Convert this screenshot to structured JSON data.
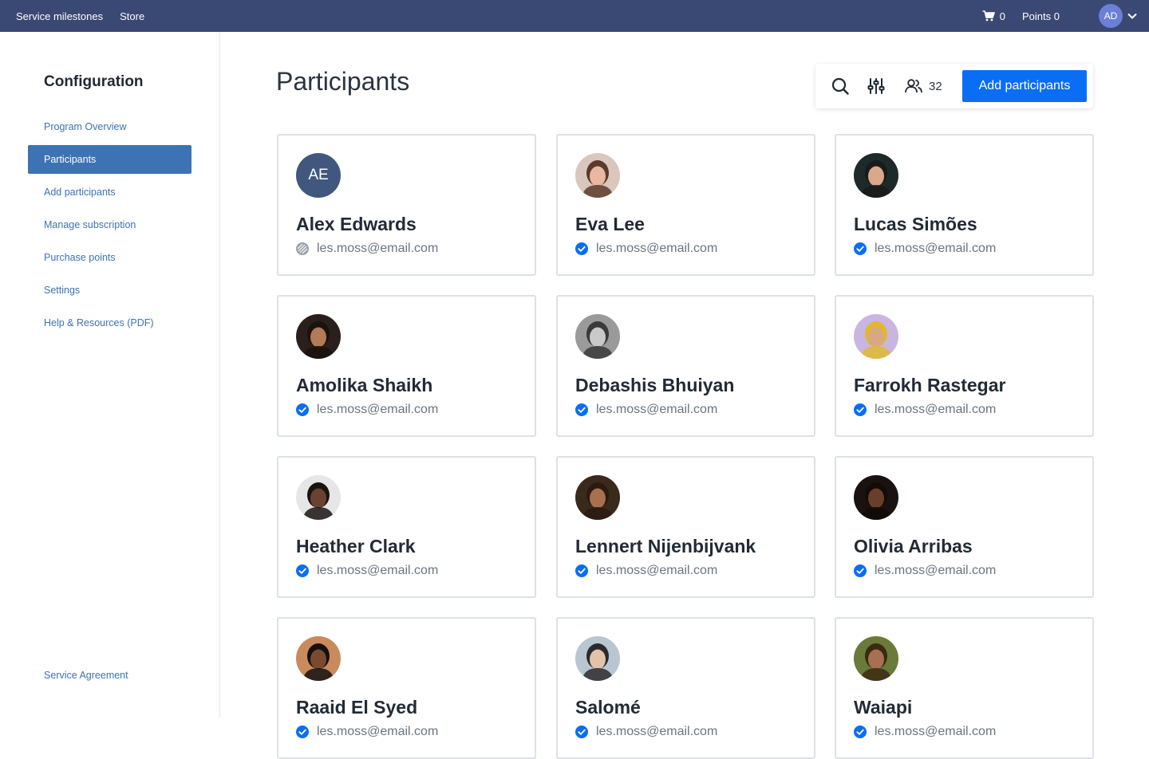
{
  "topbar": {
    "links": [
      "Service milestones",
      "Store"
    ],
    "cart_count": "0",
    "points_label": "Points 0",
    "user_initials": "AD",
    "colors": {
      "background": "#3a4874",
      "avatar": "#6b7fd7"
    }
  },
  "sidebar": {
    "title": "Configuration",
    "items": [
      {
        "label": "Program Overview",
        "active": false
      },
      {
        "label": "Participants",
        "active": true
      },
      {
        "label": "Add participants",
        "active": false
      },
      {
        "label": "Manage subscription",
        "active": false
      },
      {
        "label": "Purchase points",
        "active": false
      },
      {
        "label": "Settings",
        "active": false
      },
      {
        "label": "Help & Resources (PDF)",
        "active": false
      }
    ],
    "footer": "Service Agreement",
    "accent": "#3d72b4"
  },
  "main": {
    "title": "Participants",
    "toolbar": {
      "search_icon": "search-icon",
      "filter_icon": "sliders-icon",
      "participant_icon": "users-icon",
      "participant_count": "32",
      "add_button": "Add participants",
      "button_color": "#0a6ef5"
    },
    "participants": [
      {
        "name": "Alex Edwards",
        "email": "les.moss@email.com",
        "initials": "AE",
        "verified": false
      },
      {
        "name": "Eva Lee",
        "email": "les.moss@email.com",
        "verified": true,
        "skin": "#e8b9a0",
        "hair": "#5a3a2a",
        "bg": "#d9c7bd"
      },
      {
        "name": "Lucas Simões",
        "email": "les.moss@email.com",
        "verified": true,
        "skin": "#d9a88a",
        "hair": "#1a1a1a",
        "bg": "#1e2a2a"
      },
      {
        "name": "Amolika Shaikh",
        "email": "les.moss@email.com",
        "verified": true,
        "skin": "#b27a55",
        "hair": "#1a120e",
        "bg": "#2a1f1a"
      },
      {
        "name": "Debashis Bhuiyan",
        "email": "les.moss@email.com",
        "verified": true,
        "skin": "#c9c9c9",
        "hair": "#3a3a3a",
        "bg": "#9a9a9a"
      },
      {
        "name": "Farrokh Rastegar",
        "email": "les.moss@email.com",
        "verified": true,
        "skin": "#d8a880",
        "hair": "#e0b830",
        "bg": "#c9b6e0"
      },
      {
        "name": "Heather Clark",
        "email": "les.moss@email.com",
        "verified": true,
        "skin": "#6a4330",
        "hair": "#1a1410",
        "bg": "#e6e6e6"
      },
      {
        "name": "Lennert Nijenbijvank",
        "email": "les.moss@email.com",
        "verified": true,
        "skin": "#a8704c",
        "hair": "#2a1a10",
        "bg": "#3a2a1c"
      },
      {
        "name": "Olivia Arribas",
        "email": "les.moss@email.com",
        "verified": true,
        "skin": "#6a3f2a",
        "hair": "#120c08",
        "bg": "#1a1210"
      },
      {
        "name": "Raaid El Syed",
        "email": "les.moss@email.com",
        "verified": true,
        "skin": "#7a4a30",
        "hair": "#141010",
        "bg": "#c98a5c"
      },
      {
        "name": "Salomé",
        "email": "les.moss@email.com",
        "verified": true,
        "skin": "#e2c2a8",
        "hair": "#2a2a2e",
        "bg": "#b8c6d2"
      },
      {
        "name": "Waiapi",
        "email": "les.moss@email.com",
        "verified": true,
        "skin": "#a87050",
        "hair": "#3a2a12",
        "bg": "#6a7a3a"
      }
    ],
    "colors": {
      "card_border": "#dde1e6",
      "verified": "#0a6ef5",
      "unverified": "#9aa0a8"
    }
  }
}
